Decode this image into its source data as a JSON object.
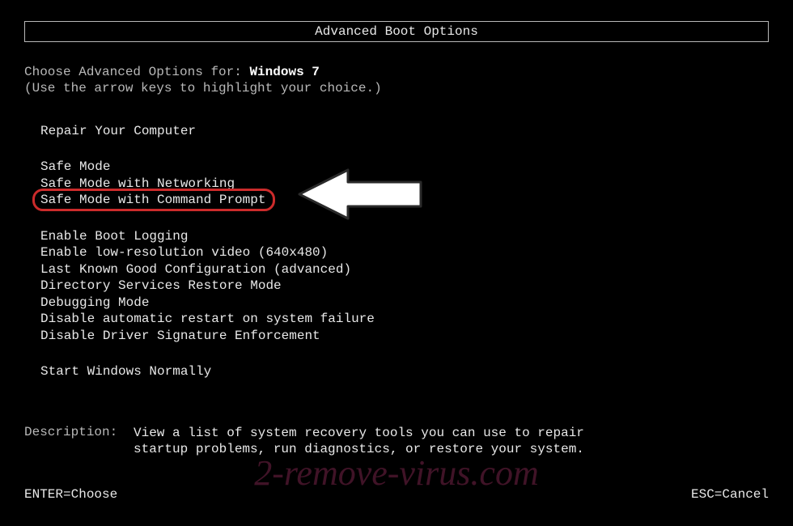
{
  "title": "Advanced Boot Options",
  "choose_prefix": "Choose Advanced Options for: ",
  "os_name": "Windows 7",
  "instruction": "(Use the arrow keys to highlight your choice.)",
  "groups": {
    "repair": "Repair Your Computer",
    "safe": [
      "Safe Mode",
      "Safe Mode with Networking",
      "Safe Mode with Command Prompt"
    ],
    "advanced": [
      "Enable Boot Logging",
      "Enable low-resolution video (640x480)",
      "Last Known Good Configuration (advanced)",
      "Directory Services Restore Mode",
      "Debugging Mode",
      "Disable automatic restart on system failure",
      "Disable Driver Signature Enforcement"
    ],
    "normal": "Start Windows Normally"
  },
  "description": {
    "label": "Description:",
    "line1": "View a list of system recovery tools you can use to repair",
    "line2": "startup problems, run diagnostics, or restore your system."
  },
  "footer": {
    "enter": "ENTER=Choose",
    "esc": "ESC=Cancel"
  },
  "watermark": "2-remove-virus.com"
}
